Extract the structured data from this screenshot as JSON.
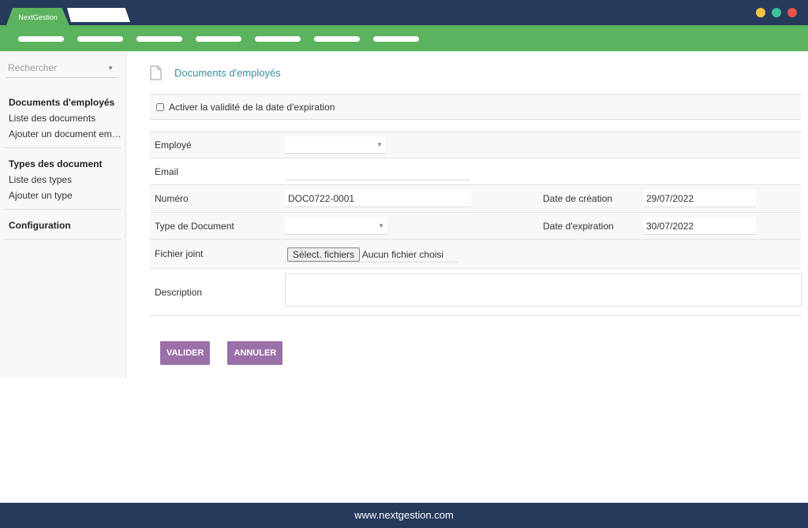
{
  "window": {
    "tab_label": "NextGestion",
    "dot_colors": [
      "#f5c342",
      "#3cc09e",
      "#e8534a"
    ]
  },
  "sidebar": {
    "search_placeholder": "Rechercher",
    "sections": [
      {
        "title": "Documents d'employés",
        "items": [
          "Liste des documents",
          "Ajouter un document em…"
        ]
      },
      {
        "title": "Types des document",
        "items": [
          "Liste des types",
          "Ajouter un type"
        ]
      },
      {
        "title": "Configuration",
        "items": []
      }
    ]
  },
  "main": {
    "title": "Documents d'employés",
    "checkbox_label": "Activer la validité de la date d'expiration",
    "fields": {
      "employe_label": "Employé",
      "employe_value": "",
      "email_label": "Email",
      "email_value": "",
      "numero_label": "Numéro",
      "numero_value": "DOC0722-0001",
      "date_creation_label": "Date de création",
      "date_creation_value": "29/07/2022",
      "type_label": "Type de Document",
      "type_value": "",
      "date_expiration_label": "Date d'expiration",
      "date_expiration_value": "30/07/2022",
      "fichier_label": "Fichier joint",
      "fichier_button": "Sélect. fichiers",
      "fichier_status": "Aucun fichier choisi",
      "description_label": "Description",
      "description_value": ""
    },
    "valider": "VALIDER",
    "annuler": "ANNULER"
  },
  "footer": {
    "text": "www.nextgestion.com"
  }
}
